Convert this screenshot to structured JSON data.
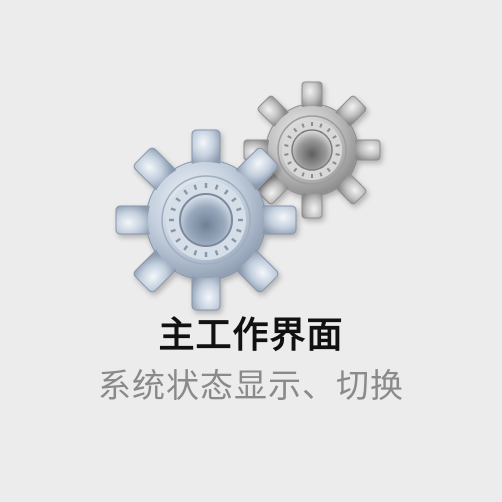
{
  "tile": {
    "icon": "gears-icon",
    "title": "主工作界面",
    "subtitle": "系统状态显示、切换"
  },
  "colors": {
    "background": "#ececec",
    "title": "#111111",
    "subtitle": "#8a8a8a",
    "gear_large": "#b9c6d6",
    "gear_small": "#b8b8b8"
  }
}
